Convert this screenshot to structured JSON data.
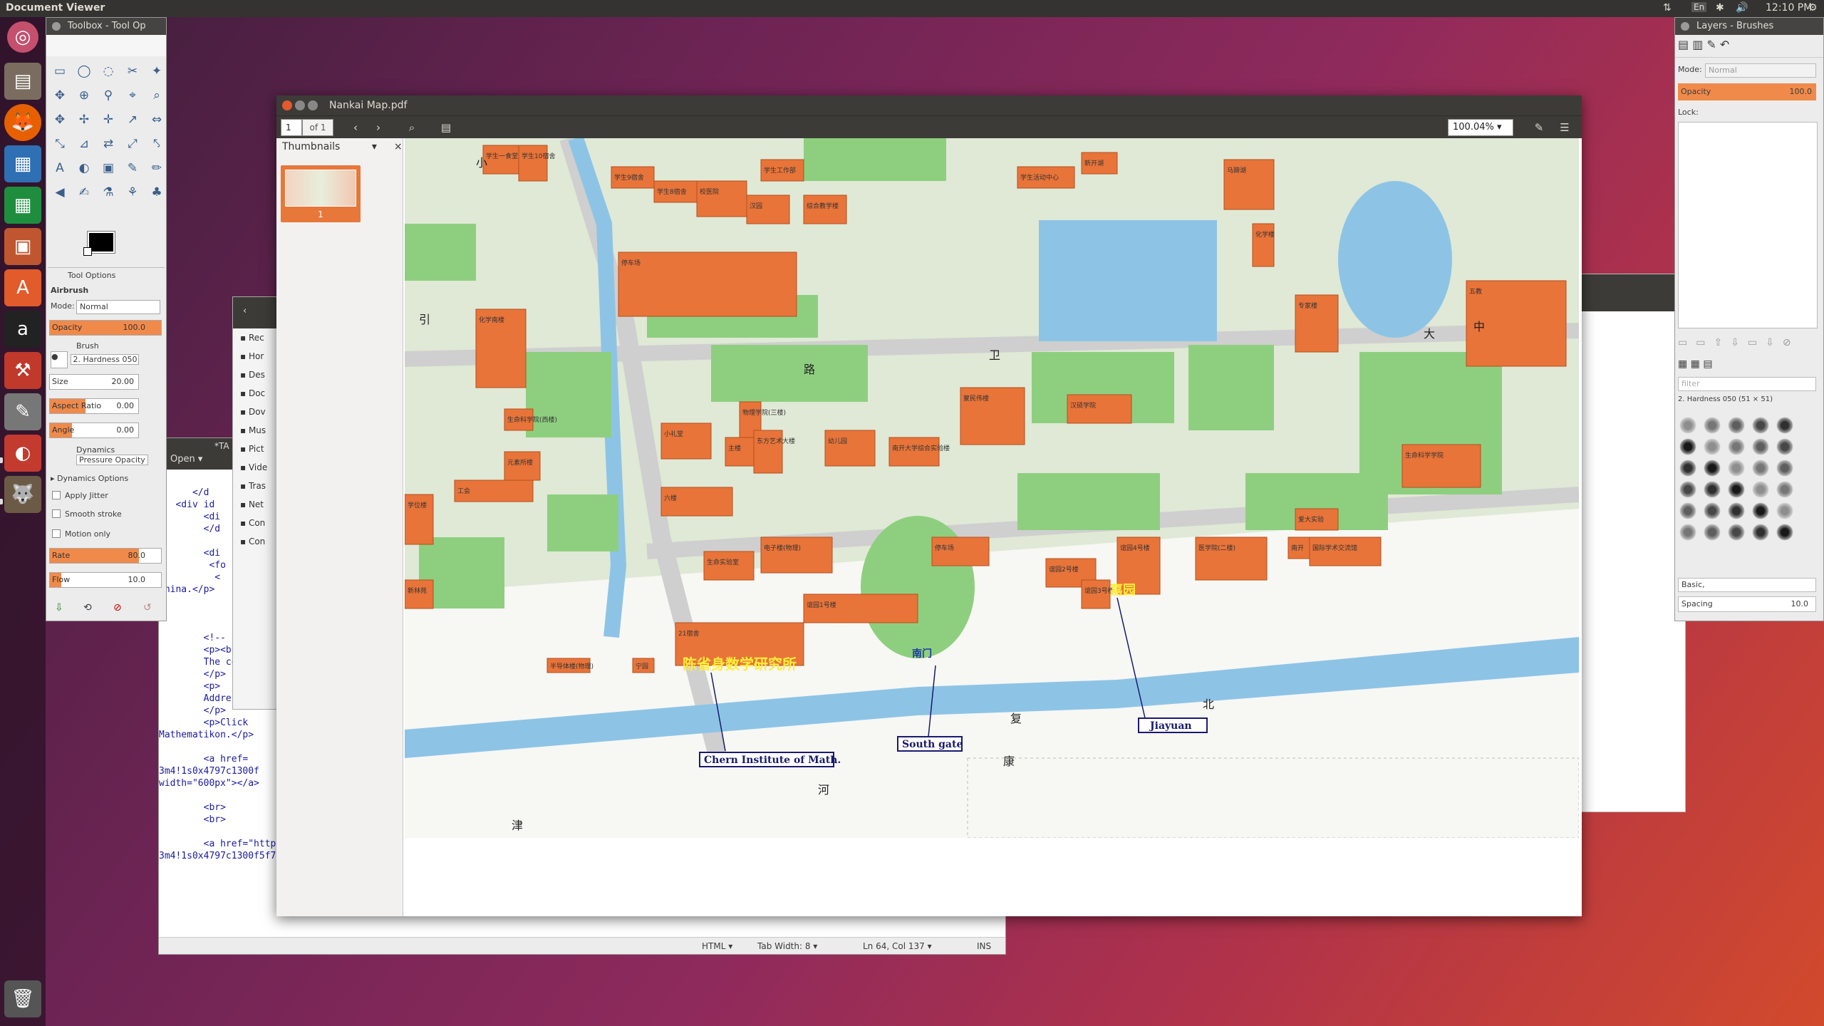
{
  "topbar": {
    "app_title": "Document Viewer",
    "time": "12:10 PM",
    "kbd": "En"
  },
  "launcher": {
    "items": [
      {
        "name": "dash",
        "color": "#cc5c35"
      },
      {
        "name": "files",
        "color": "#7a6d5f"
      },
      {
        "name": "firefox",
        "color": "#e66000"
      },
      {
        "name": "writer",
        "color": "#2f6fb3"
      },
      {
        "name": "calc",
        "color": "#1e8e3e"
      },
      {
        "name": "impress",
        "color": "#c0562f"
      },
      {
        "name": "software",
        "color": "#e25b2a"
      },
      {
        "name": "amazon",
        "color": "#222222"
      },
      {
        "name": "settings",
        "color": "#c0392b"
      },
      {
        "name": "text-editor",
        "color": "#777777"
      },
      {
        "name": "evince",
        "color": "#c33a2f"
      },
      {
        "name": "gimp",
        "color": "#6b5a45"
      },
      {
        "name": "trash",
        "color": "#666666"
      }
    ]
  },
  "toolbox": {
    "title": "Toolbox - Tool Op",
    "tool_options_tab": "Tool Options",
    "tool_name": "Airbrush",
    "mode_label": "Mode:",
    "mode_value": "Normal",
    "opacity_label": "Opacity",
    "opacity_value": "100.0",
    "opacity_level": 1.0,
    "brush_label": "Brush",
    "brush_value": "2. Hardness 050",
    "size_label": "Size",
    "size_value": "20.00",
    "aspect_label": "Aspect Ratio",
    "aspect_value": "0.00",
    "angle_label": "Angle",
    "angle_value": "0.00",
    "dynamics_label": "Dynamics",
    "dynamics_value": "Pressure Opacity",
    "dynamics_options": "Dynamics Options",
    "apply_jitter": "Apply Jitter",
    "smooth_stroke": "Smooth stroke",
    "motion_only": "Motion only",
    "rate_label": "Rate",
    "rate_value": "80.0",
    "rate_level": 0.8,
    "flow_label": "Flow",
    "flow_value": "10.0",
    "flow_level": 0.1
  },
  "gedit": {
    "open_label": "Open",
    "tab_title": "*TA",
    "code_lines": [
      "      </d",
      "   <div id",
      "        <di",
      "        </d",
      "",
      "        <di",
      "         <fo",
      "          <",
      "China.</p>",
      "",
      "",
      "",
      "        <!--",
      "        <p><br>",
      "        The conf",
      "        </p>",
      "        <p>",
      "        Address:",
      "        </p>",
      "        <p>Click",
      "Mathematikon.</p>",
      "",
      "        <a href=",
      "3m4!1s0x4797c1300f",
      "width=\"600px\"></a>",
      "",
      "        <br>",
      "        <br>",
      "",
      "        <a href=\"https://www.google.de/maps/place/Im+Neuenheimer+Feld+205,+69120+Heidelberg/@49.4161779,8.6749305,17z/data=!4m5!",
      "3m4!1s0x4797c1300f5f793b:0xc9a655b854232c33!8m2!3d49.4172982!4d8.675424?hl=en\"><img src=\"Mathematikon_small_map.png\";"
    ],
    "status_lang": "HTML",
    "status_tab": "Tab Width: 8",
    "status_pos": "Ln 64, Col 137",
    "status_ins": "INS"
  },
  "files": {
    "items": [
      "Rec",
      "Hor",
      "Des",
      "Doc",
      "Dov",
      "Mus",
      "Pict",
      "Vide",
      "Tras",
      "Net",
      "Con",
      "Con"
    ]
  },
  "evince": {
    "title": "Nankai Map.pdf",
    "page_value": "1",
    "page_of": "of 1",
    "zoom": "100.04%",
    "sidebar_title": "Thumbnails",
    "thumb_label": "1"
  },
  "map": {
    "labels": {
      "chern": "陈省身数学研究所",
      "jiayuan_cn": "嘉园",
      "south_gate_cn": "南门",
      "chern_en": "Chern Institute of Math.",
      "south_gate_en": "South gate",
      "jiayuan_en": "Jiayuan"
    },
    "buildings": [
      "学生一食堂",
      "学生10宿舍",
      "学生9宿舍",
      "学生8宿舍",
      "学生工作部",
      "校医院",
      "汉园",
      "综合教学楼",
      "停车场",
      "学生活动中心",
      "新开湖",
      "马蹄湖",
      "化学楼",
      "化学南楼",
      "生命科学院(西楼)",
      "工会",
      "小礼堂",
      "主楼",
      "物理学院(三楼)",
      "东方艺术大楼",
      "幼儿园",
      "南开大学综合实验楼",
      "蒙民伟楼",
      "汉硕学院",
      "专家楼",
      "五教",
      "生命科学学院",
      "元素所楼",
      "六楼",
      "电子楼(物理)",
      "停车场",
      "生命实验室",
      "学位楼",
      "新林苑",
      "医学院(二楼)",
      "爱大实验",
      "国际学术交流馆",
      "谊园2号楼",
      "谊园3号楼",
      "谊园4号楼",
      "谊园1号楼",
      "21宿舍",
      "半导体楼(物理)",
      "宁园",
      "南开"
    ],
    "roads": [
      "大",
      "中",
      "路",
      "卫",
      "津",
      "河",
      "康",
      "复",
      "北",
      "引",
      "小"
    ]
  },
  "layers": {
    "title": "Layers - Brushes",
    "mode_label": "Mode:",
    "mode_value": "Normal",
    "opacity_label": "Opacity",
    "opacity_value": "100.0",
    "lock_label": "Lock:",
    "filter_placeholder": "filter",
    "brush_name": "2. Hardness 050 (51 × 51)",
    "tag_value": "Basic,",
    "spacing_label": "Spacing",
    "spacing_value": "10.0"
  }
}
